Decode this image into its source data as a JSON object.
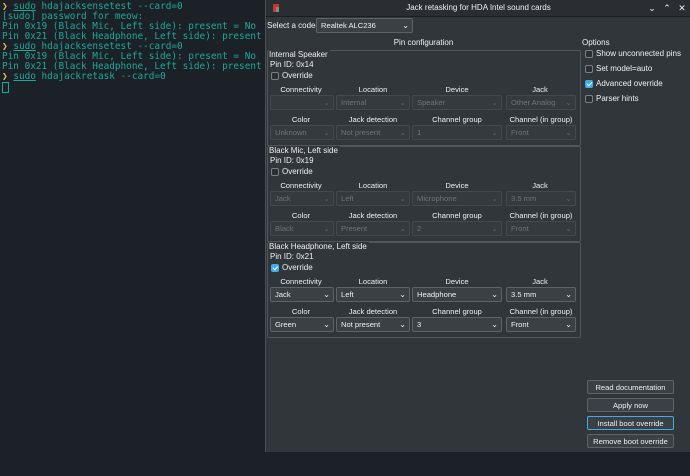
{
  "terminal": {
    "lines": [
      {
        "prompt": "❯",
        "cmd": "sudo",
        "rest": " hdajacksensetest --card=0"
      },
      {
        "text": "[sudo] password for meow:"
      },
      {
        "text": "Pin 0x19 (Black Mic, Left side): present = No"
      },
      {
        "text": "Pin 0x21 (Black Headphone, Left side): present = No"
      },
      {
        "prompt": "❯",
        "cmd": "sudo",
        "rest": " hdajacksensetest --card=0"
      },
      {
        "text": "Pin 0x19 (Black Mic, Left side): present = No"
      },
      {
        "text": "Pin 0x21 (Black Headphone, Left side): present = No"
      },
      {
        "prompt": "❯",
        "cmd": "sudo",
        "rest": " hdajackretask --card=0"
      }
    ]
  },
  "window": {
    "title": "Jack retasking for HDA Intel sound cards",
    "minimize": "⌄",
    "maximize": "⌃",
    "close": "✕"
  },
  "codec": {
    "label": "Select a codec:",
    "value": "Realtek ALC236"
  },
  "pin_config": {
    "title": "Pin configuration",
    "headers_row1": [
      "Connectivity",
      "Location",
      "Device",
      "Jack"
    ],
    "headers_row2": [
      "Color",
      "Jack detection",
      "Channel group",
      "Channel (in group)"
    ],
    "groups": [
      {
        "title": "Internal Speaker",
        "pin_id": "Pin ID: 0x14",
        "override_label": "Override",
        "override": false,
        "row1": [
          "",
          "Internal",
          "Speaker",
          "Other Analog"
        ],
        "row2": [
          "Unknown",
          "Not present",
          "1",
          "Front"
        ]
      },
      {
        "title": "Black Mic, Left side",
        "pin_id": "Pin ID: 0x19",
        "override_label": "Override",
        "override": false,
        "row1": [
          "Jack",
          "Left",
          "Microphone",
          "3.5 mm"
        ],
        "row2": [
          "Black",
          "Present",
          "2",
          "Front"
        ]
      },
      {
        "title": "Black Headphone, Left side",
        "pin_id": "Pin ID: 0x21",
        "override_label": "Override",
        "override": true,
        "row1": [
          "Jack",
          "Left",
          "Headphone",
          "3.5 mm"
        ],
        "row2": [
          "Green",
          "Not present",
          "3",
          "Front"
        ]
      }
    ]
  },
  "options": {
    "title": "Options",
    "items": [
      {
        "label": "Show unconnected pins",
        "checked": false
      },
      {
        "label": "Set model=auto",
        "checked": false
      },
      {
        "label": "Advanced override",
        "checked": true
      },
      {
        "label": "Parser hints",
        "checked": false
      }
    ]
  },
  "buttons": {
    "read_docs": "Read documentation",
    "apply_now": "Apply now",
    "install_boot": "Install boot override",
    "remove_boot": "Remove boot override"
  },
  "colors": {
    "accent": "#3daee9",
    "terminal_green": "#1da89a",
    "window_bg": "#31363b"
  }
}
